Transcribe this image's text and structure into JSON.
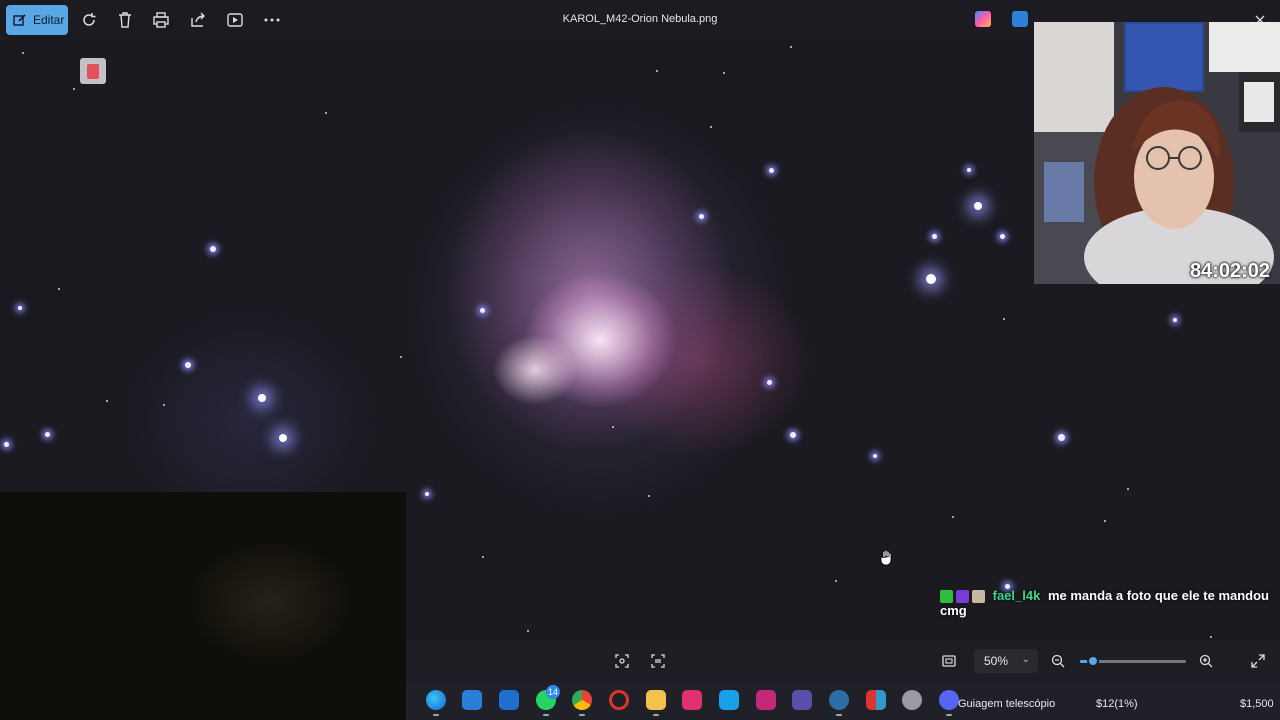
{
  "toolbar": {
    "edit_label": "Editar",
    "file_title": "KAROL_M42-Orion Nebula.png",
    "icons": [
      "edit-icon",
      "rotate-icon",
      "delete-icon",
      "print-icon",
      "share-icon",
      "slideshow-icon",
      "more-icon"
    ]
  },
  "webcam": {
    "timer": "84:02:02"
  },
  "chat": {
    "username": "fael_l4k",
    "message": "me manda a foto que ele te mandou cmg"
  },
  "viewer": {
    "zoom_level": "50%",
    "zoom_fraction": 0.12
  },
  "taskbar": {
    "whatsapp_badge": "14",
    "ticker_label": "Guiagem telescópio",
    "ticker_value": "$12(1%)",
    "ticker_price": "$1,500"
  },
  "colors": {
    "accent": "#5aa7e6",
    "chat_username": "#39d98a",
    "toolbar_bg": "#1c1b22"
  }
}
